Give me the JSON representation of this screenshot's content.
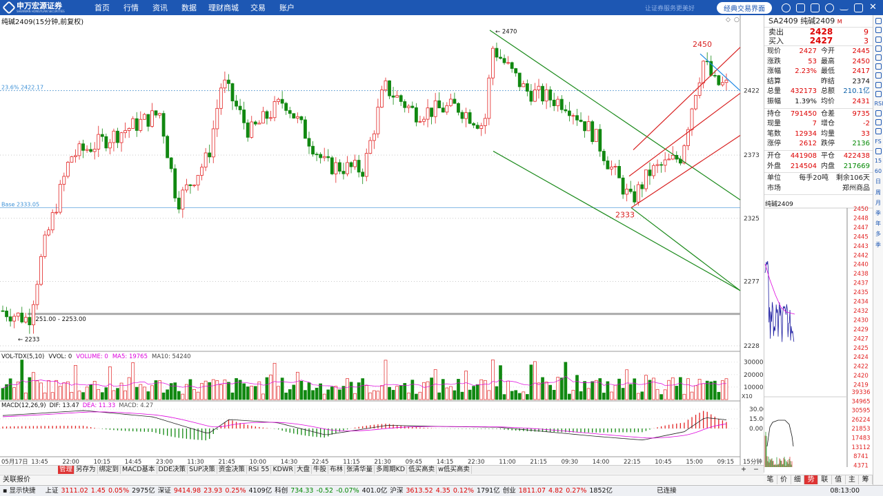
{
  "app": {
    "brand": "申万宏源证券",
    "brand_en": "SHENWAN HONGYUAN SECURITIES",
    "slogan": "让证券服务更美好",
    "classic_button": "经典交易界面",
    "menu": [
      "首页",
      "行情",
      "资讯",
      "数据",
      "理财商城",
      "交易",
      "账户"
    ]
  },
  "chart": {
    "title": "纯碱2409(15分钟,前复权)",
    "fib_label": "23.6% 2422.17",
    "base_label": "Base 2333.05",
    "range_label": "2251.00 - 2253.00",
    "low_label": "2233",
    "high_label": "2470",
    "peak_label": "2450",
    "trough_label": "2333",
    "price_axis": [
      "2422",
      "2373",
      "2325",
      "2277",
      "2228"
    ],
    "time_axis": [
      "05月17日",
      "13:45",
      "22:00",
      "10:15",
      "14:45",
      "23:00",
      "11:30",
      "21:45",
      "10:00",
      "14:30",
      "22:45",
      "11:15",
      "21:30",
      "09:45",
      "14:15",
      "22:30",
      "11:00",
      "21:15",
      "09:30",
      "14:00",
      "22:15",
      "10:45",
      "15:00",
      "09:15"
    ],
    "colors": {
      "up": "#e22222",
      "down": "#118811",
      "channel_green": "#1b8a1b",
      "channel_red": "#d81f1f",
      "trend_blue": "#1e88e5",
      "fib": "#3a8fd6"
    }
  },
  "vol": {
    "title": "VOL-TDX(5,10)",
    "vvol": "VVOL: 0",
    "volume": "VOLUME: 0",
    "ma5": "MA5: 19765",
    "ma10": "MA10: 54240",
    "axis": [
      "30000",
      "20000",
      "10000"
    ],
    "unit": "X10"
  },
  "macd": {
    "title": "MACD(12,26,9)",
    "dif": "DIF: 13.47",
    "dea": "DEA: 11.33",
    "macd": "MACD: 4.27",
    "axis": [
      "30.00",
      "15.00",
      "0.00"
    ]
  },
  "chart_data": {
    "type": "candlestick",
    "symbol": "SA2409",
    "interval": "15分钟",
    "ylim": [
      2228,
      2470
    ],
    "peak": 2450,
    "trough": 2333,
    "high": 2470,
    "low": 2233,
    "vol_labels": {
      "ma5": 19765,
      "ma10": 54240
    },
    "macd_labels": {
      "dif": 13.47,
      "dea": 11.33,
      "macd": 4.27
    }
  },
  "quote": {
    "header": "SA2409 纯碱2409",
    "header_tag": "M",
    "sell": {
      "label": "卖出",
      "price": "2428",
      "qty": "9"
    },
    "buy": {
      "label": "买入",
      "price": "2427",
      "qty": "3"
    },
    "stats": [
      [
        [
          "现价",
          "2427",
          "red"
        ],
        [
          "今开",
          "2445",
          "red"
        ]
      ],
      [
        [
          "涨跌",
          "53",
          "red"
        ],
        [
          "最高",
          "2450",
          "red"
        ]
      ],
      [
        [
          "涨幅",
          "2.23%",
          "red"
        ],
        [
          "最低",
          "2417",
          "red"
        ]
      ],
      [
        [
          "结算",
          "",
          ""
        ],
        [
          "昨结",
          "2374",
          "blk"
        ]
      ],
      [
        [
          "总量",
          "432173",
          "red"
        ],
        [
          "总额",
          "210.1亿",
          "blu"
        ]
      ],
      [
        [
          "振幅",
          "1.39%",
          "blk"
        ],
        [
          "均价",
          "2431",
          "red"
        ]
      ]
    ],
    "stats2": [
      [
        [
          "持仓",
          "791450",
          "red"
        ],
        [
          "仓差",
          "9735",
          "red"
        ]
      ],
      [
        [
          "现量",
          "7",
          "red"
        ],
        [
          "增仓",
          "-2",
          "red"
        ]
      ],
      [
        [
          "笔数",
          "12934",
          "red"
        ],
        [
          "均量",
          "33",
          "red"
        ]
      ],
      [
        [
          "涨停",
          "2612",
          "red"
        ],
        [
          "跌停",
          "2136",
          "green"
        ]
      ]
    ],
    "stats3": [
      [
        [
          "开仓",
          "441908",
          "red"
        ],
        [
          "平仓",
          "422438",
          "red"
        ]
      ],
      [
        [
          "外盘",
          "214504",
          "red"
        ],
        [
          "内盘",
          "217669",
          "green"
        ]
      ]
    ],
    "unit": {
      "label": "单位",
      "value": "每手20吨",
      "remain": "剩余106天"
    },
    "market": {
      "label": "市场",
      "value": "郑州商品"
    },
    "mini_title": "纯碱2409",
    "mini_axis": [
      "2450",
      "2448",
      "2447",
      "2445",
      "2443",
      "2442",
      "2440",
      "2438",
      "2437",
      "2435",
      "2434",
      "2432",
      "2430",
      "2429",
      "2427",
      "2425",
      "2424",
      "2422",
      "2420",
      "2419"
    ],
    "mini_vol_axis": [
      "39336",
      "34965",
      "30595",
      "26224",
      "21853",
      "17483",
      "13112",
      "8741",
      "4371"
    ],
    "tabs": [
      "笔",
      "价",
      "细",
      "势",
      "联",
      "值",
      "主",
      "筹"
    ]
  },
  "bottom_tabs": [
    "管理",
    "另存为",
    "绑定到",
    "MACD基本",
    "DDE决策",
    "SUP决策",
    "资金决策",
    "RSI 55",
    "KDWR",
    "大盘",
    "牛股",
    "布林",
    "张清华量",
    "多周期KD",
    "低买高卖",
    "w低买高卖"
  ],
  "quote_line": "关联报价",
  "status": {
    "quick": "显示快捷",
    "items": [
      [
        "上证",
        "3111.02",
        "1.45",
        "0.05%",
        "2975亿"
      ],
      [
        "深证",
        "9414.98",
        "23.93",
        "0.25%",
        "4109亿"
      ],
      [
        "科创",
        "734.33",
        "-0.52",
        "-0.07%",
        "401.0亿"
      ],
      [
        "沪深",
        "3613.52",
        "4.35",
        "0.12%",
        "1791亿"
      ],
      [
        "创业",
        "1811.07",
        "4.82",
        "0.27%",
        "1852亿"
      ]
    ],
    "connected": "已连接",
    "time": "08:13:00"
  },
  "sidebar_icons": [
    "x-icon",
    "settings-icon",
    "grid-icon",
    "bars-icon",
    "list-icon",
    "chart-icon",
    "table-icon",
    "doc-icon",
    "calendar-icon",
    "rsi-icon",
    "plus-icon",
    "move-icon",
    "pen-icon",
    "fs-icon",
    "lock-icon",
    "15-icon",
    "60-icon",
    "day-icon",
    "week-icon",
    "month-icon",
    "quarter-icon",
    "year-icon",
    "multi-icon",
    "time-icon"
  ],
  "sidebar_text": [
    "",
    "",
    "",
    "",
    "",
    "",
    "",
    "",
    "",
    "RSI",
    "",
    "",
    "",
    "FS",
    "",
    "15",
    "60",
    "日",
    "周",
    "月",
    "季",
    "年",
    "多",
    "季"
  ]
}
